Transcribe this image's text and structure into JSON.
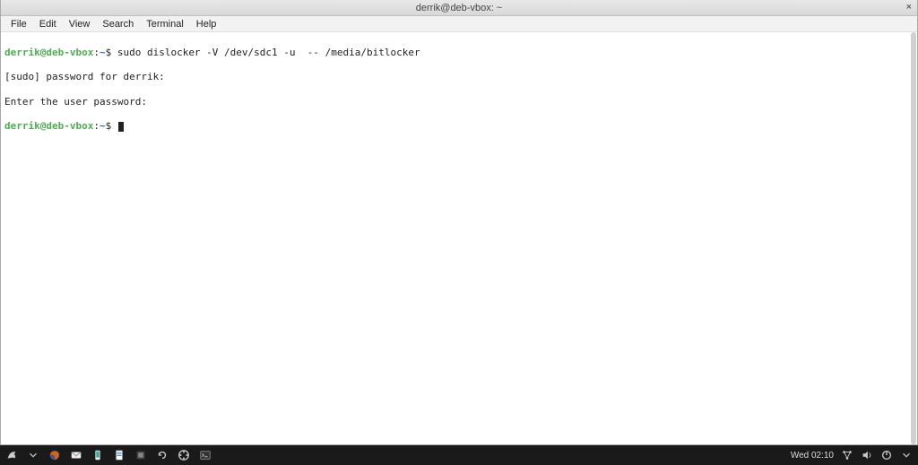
{
  "window": {
    "title": "derrik@deb-vbox: ~",
    "close": "×"
  },
  "menu": {
    "file": "File",
    "edit": "Edit",
    "view": "View",
    "search": "Search",
    "terminal": "Terminal",
    "help": "Help"
  },
  "prompt": {
    "userhost": "derrik@deb-vbox",
    "sep": ":",
    "path": "~",
    "symbol": "$"
  },
  "terminal": {
    "command1": "sudo dislocker -V /dev/sdc1 -u  -- /media/bitlocker",
    "line2": "[sudo] password for derrik:",
    "line3": "Enter the user password:"
  },
  "panel": {
    "clock": "Wed 02:10"
  }
}
